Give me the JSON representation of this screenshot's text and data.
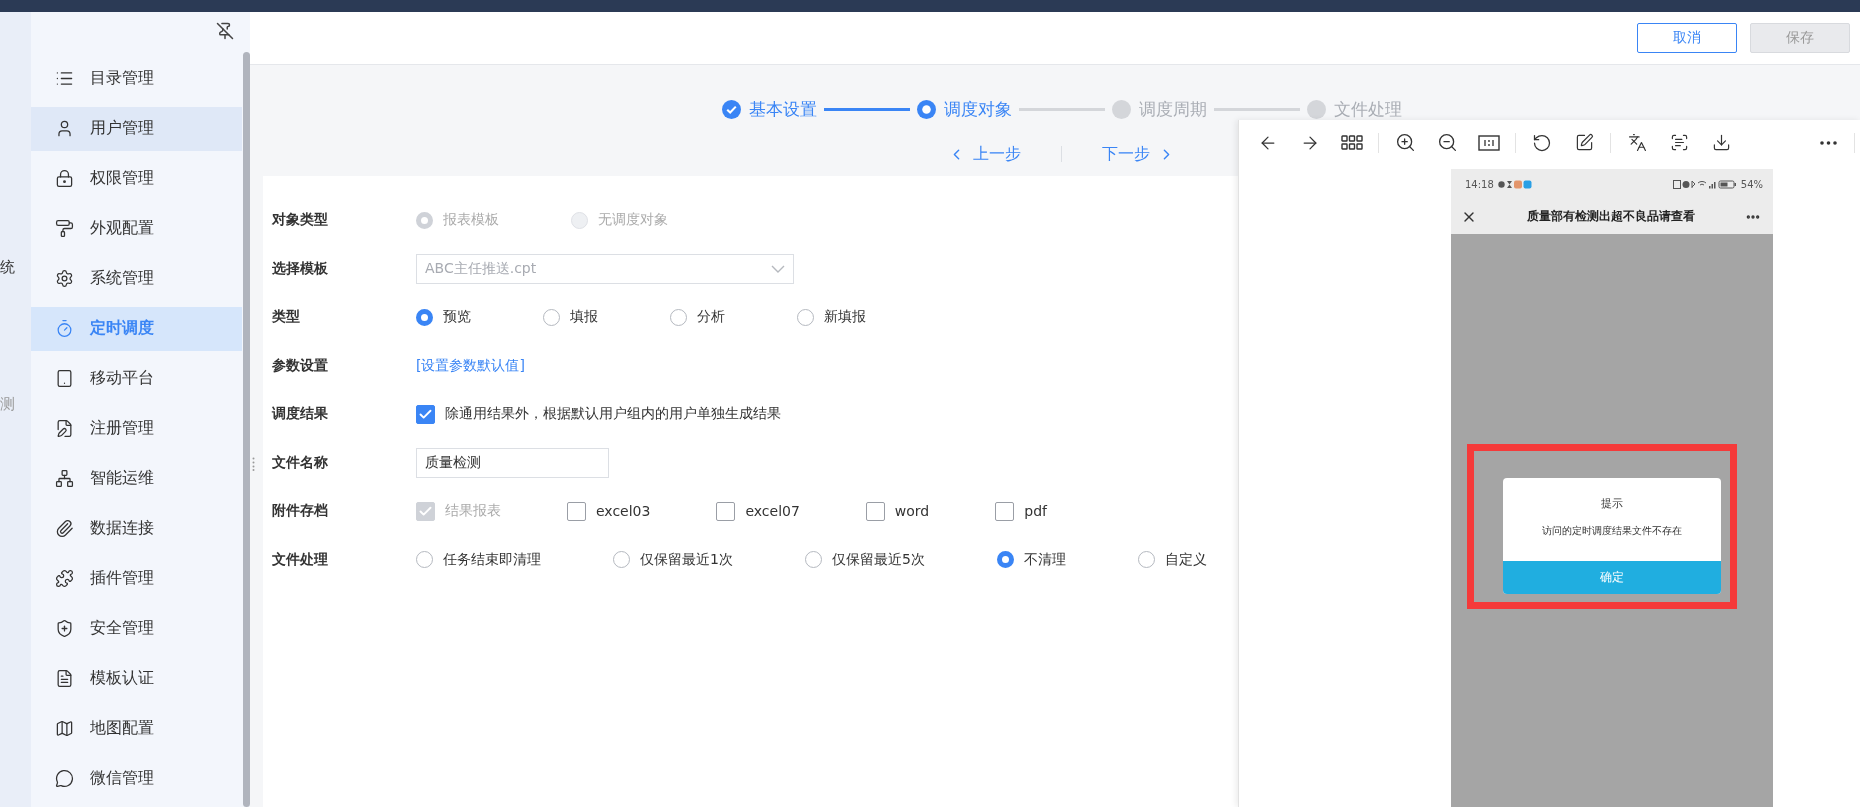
{
  "left_strip": {
    "texts": [
      "统",
      "测"
    ]
  },
  "sidebar": {
    "items": [
      {
        "label": "目录管理",
        "selected": false,
        "hovered": false
      },
      {
        "label": "用户管理",
        "selected": false,
        "hovered": true
      },
      {
        "label": "权限管理",
        "selected": false,
        "hovered": false
      },
      {
        "label": "外观配置",
        "selected": false,
        "hovered": false
      },
      {
        "label": "系统管理",
        "selected": false,
        "hovered": false
      },
      {
        "label": "定时调度",
        "selected": true,
        "hovered": false
      },
      {
        "label": "移动平台",
        "selected": false,
        "hovered": false
      },
      {
        "label": "注册管理",
        "selected": false,
        "hovered": false
      },
      {
        "label": "智能运维",
        "selected": false,
        "hovered": false
      },
      {
        "label": "数据连接",
        "selected": false,
        "hovered": false
      },
      {
        "label": "插件管理",
        "selected": false,
        "hovered": false
      },
      {
        "label": "安全管理",
        "selected": false,
        "hovered": false
      },
      {
        "label": "模板认证",
        "selected": false,
        "hovered": false
      },
      {
        "label": "地图配置",
        "selected": false,
        "hovered": false
      },
      {
        "label": "微信管理",
        "selected": false,
        "hovered": false
      }
    ]
  },
  "header_buttons": [
    {
      "label": "取消",
      "disabled": false
    },
    {
      "label": "保存",
      "disabled": true
    }
  ],
  "steps": [
    {
      "label": "基本设置",
      "done": true,
      "selected": false
    },
    {
      "label": "调度对象",
      "done": false,
      "selected": true
    },
    {
      "label": "调度周期",
      "done": false,
      "selected": false
    },
    {
      "label": "文件处理",
      "done": false,
      "selected": false
    }
  ],
  "step_nav": {
    "prev": "上一步",
    "next": "下一步"
  },
  "form": [
    {
      "label": "对象类型",
      "kind": "radio",
      "disabled": true,
      "options": [
        {
          "label": "报表模板",
          "selected": true
        },
        {
          "label": "无调度对象",
          "selected": false
        }
      ]
    },
    {
      "label": "选择模板",
      "kind": "select",
      "value": "ABC主任推送.cpt",
      "disabled": true
    },
    {
      "label": "类型",
      "kind": "radio",
      "disabled": false,
      "options": [
        {
          "label": "预览",
          "selected": true
        },
        {
          "label": "填报",
          "selected": false
        },
        {
          "label": "分析",
          "selected": false
        },
        {
          "label": "新填报",
          "selected": false
        }
      ]
    },
    {
      "label": "参数设置",
      "kind": "link",
      "text": "[设置参数默认值]"
    },
    {
      "label": "调度结果",
      "kind": "checkbox",
      "options": [
        {
          "label": "除通用结果外，根据默认用户组内的用户单独生成结果",
          "checked": true,
          "disabled": false
        }
      ]
    },
    {
      "label": "文件名称",
      "kind": "input",
      "value": "质量检测"
    },
    {
      "label": "附件存档",
      "kind": "checkbox",
      "options": [
        {
          "label": "结果报表",
          "checked": true,
          "disabled": true
        },
        {
          "label": "excel03",
          "checked": false,
          "disabled": false
        },
        {
          "label": "excel07",
          "checked": false,
          "disabled": false
        },
        {
          "label": "word",
          "checked": false,
          "disabled": false
        },
        {
          "label": "pdf",
          "checked": false,
          "disabled": false
        }
      ]
    },
    {
      "label": "文件处理",
      "kind": "radio",
      "disabled": false,
      "options": [
        {
          "label": "任务结束即清理",
          "selected": false
        },
        {
          "label": "仅保留最近1次",
          "selected": false
        },
        {
          "label": "仅保留最近5次",
          "selected": false
        },
        {
          "label": "不清理",
          "selected": true
        },
        {
          "label": "自定义",
          "selected": false
        }
      ]
    }
  ],
  "image_viewer": {
    "phone": {
      "time": "14:18",
      "battery": "54%",
      "title": "质量部有检测出超不良品请查看",
      "dialog": {
        "title": "提示",
        "message": "访问的定时调度结果文件不存在",
        "button": "确定"
      }
    }
  }
}
